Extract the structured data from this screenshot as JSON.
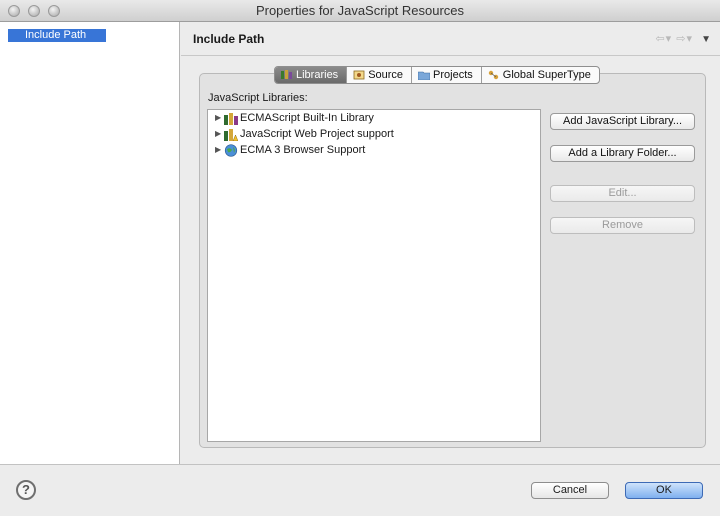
{
  "window": {
    "title": "Properties for JavaScript Resources"
  },
  "sidebar": {
    "items": [
      {
        "label": "Include Path",
        "selected": true
      }
    ]
  },
  "header": {
    "title": "Include Path",
    "nav_icons": [
      "back-arrow-icon",
      "forward-arrow-icon",
      "view-menu-icon"
    ]
  },
  "tabs": [
    {
      "label": "Libraries",
      "icon": "libraries-icon",
      "active": true
    },
    {
      "label": "Source",
      "icon": "source-icon",
      "active": false
    },
    {
      "label": "Projects",
      "icon": "projects-folder-icon",
      "active": false
    },
    {
      "label": "Global SuperType",
      "icon": "supertype-icon",
      "active": false
    }
  ],
  "libraries": {
    "label": "JavaScript Libraries:",
    "items": [
      {
        "label": "ECMAScript Built-In Library",
        "icon": "library-icon"
      },
      {
        "label": "JavaScript Web Project support",
        "icon": "library-warning-icon"
      },
      {
        "label": "ECMA 3 Browser Support",
        "icon": "globe-icon"
      }
    ]
  },
  "buttons": {
    "add_library": "Add JavaScript Library...",
    "add_folder": "Add a Library Folder...",
    "edit": "Edit...",
    "remove": "Remove"
  },
  "footer": {
    "help": "?",
    "cancel": "Cancel",
    "ok": "OK"
  },
  "colors": {
    "selection": "#3875d7",
    "ok_button": "#7fb0ef"
  }
}
